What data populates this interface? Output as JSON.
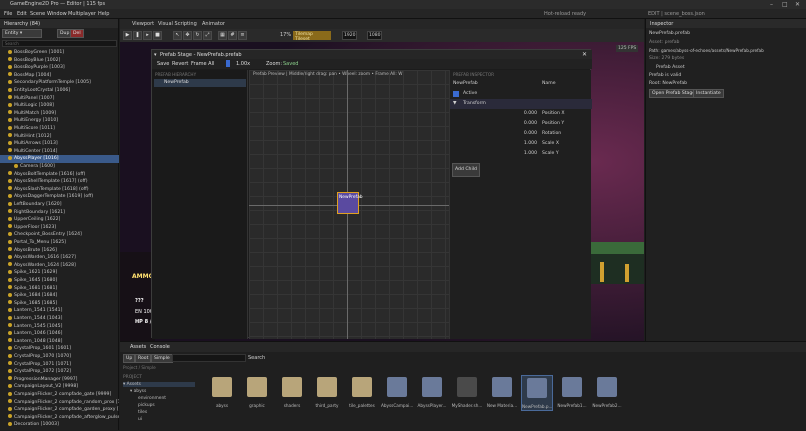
{
  "titlebar": {
    "title": "GameEngine2D Pro — Editor | 115 fps"
  },
  "menubar": {
    "items": [
      "File",
      "Edit",
      "Scene",
      "Window",
      "Multiplayer",
      "Help"
    ],
    "status": "Hot-reload ready",
    "edit_status": "EDIT | scene_boss.json"
  },
  "hierarchy": {
    "title": "Hierarchy (84)",
    "mode": "Entity",
    "dup": "Dup",
    "del": "Del",
    "search_placeholder": "Search",
    "items": [
      "BossBoyGreen [1001]",
      "BossBoyBlue [1002]",
      "BossBoyPurple [1003]",
      "BossMap [1004]",
      "SecondaryPlatformTemple [1005]",
      "EntityLootCrystal [1006]",
      "MultiPanel [1007]",
      "MultiLogic [1008]",
      "MultiMatch [1009]",
      "MultiEnergy [1010]",
      "MultiScore [1011]",
      "MultiHint [1012]",
      "MultiArrows [1013]",
      "MultiCenter [1014]",
      "AbyssPlayer [1016]",
      "Camera [1600]",
      "AbyssBoltTemplate [1616] (off)",
      "AbyssShellTemplate [1617] (off)",
      "AbyssSlashTemplate [1618] (off)",
      "AbyssDaggerTemplate [1619] (off)",
      "LeftBoundary [1620]",
      "RightBoundary [1621]",
      "UpperCeiling [1622]",
      "UpperFloor [1623]",
      "Checkpoint_BossEntry [1624]",
      "Portal_To_Menu [1625]",
      "AbyssBrute [1626]",
      "AbyssWarden_1616 [1627]",
      "AbyssWarden_1624 [1628]",
      "Spike_1621 [1629]",
      "Spike_1645 [1680]",
      "Spike_1681 [1681]",
      "Spike_1684 [1684]",
      "Spike_1685 [1685]",
      "Lantern_1541 [1541]",
      "Lantern_1544 [1043]",
      "Lantern_1545 [1045]",
      "Lantern_1046 [1046]",
      "Lantern_1048 [1048]",
      "CrystalProp_1601 [1601]",
      "CrystalProp_1070 [1070]",
      "CrystalProp_1071 [1071]",
      "CrystalProp_1072 [1072]",
      "ProgressionManager [9997]",
      "CampaignLayout_V2 [9998]",
      "CampaignFlicker_2 compfade_gate [9999]",
      "CampaignFlicker_2 compfade_random_prox [10000]",
      "CampaignFlicker_2 compfade_garden_proxy [10001]",
      "CampaignFlicker_2 compfade_afterglow_pulse [10002]",
      "Decoration [10003]"
    ]
  },
  "scene": {
    "tabs": [
      "Viewport",
      "Visual Scripting",
      "Animator"
    ],
    "toolbar_badge": "Tilemap Tileset",
    "zoom": "17%",
    "res_w": "1920",
    "res_h": "1080",
    "fps_badge": "125 FPS",
    "hud_texts": [
      "AMMO",
      "???",
      "EN 100",
      "HP 8 /"
    ]
  },
  "prefab": {
    "title": "Prefab Stage - NewPrefab.prefab",
    "buttons": [
      "Save",
      "Revert",
      "Frame All"
    ],
    "zoom_value": "1.00x",
    "zoom_label": "Zoom:",
    "saved": "Saved",
    "hierarchy_header": "PREFAB HIERARCHY",
    "root_item": "NewPrefab",
    "preview_header": "Prefab Preview | Middle/right drag: pan • Wheel: zoom • Frame All: W",
    "entity_label": "NewPrefab",
    "inspector_header": "PREFAB INSPECTOR",
    "name_value": "NewPrefab",
    "name_label": "Name",
    "active_label": "Active",
    "transform_label": "Transform",
    "fields": [
      {
        "value": "0.000",
        "label": "Position X"
      },
      {
        "value": "0.000",
        "label": "Position Y"
      },
      {
        "value": "0.000",
        "label": "Rotation"
      },
      {
        "value": "1.000",
        "label": "Scale X"
      },
      {
        "value": "1.000",
        "label": "Scale Y"
      }
    ],
    "add_child": "Add Child"
  },
  "inspector": {
    "title": "Inspector",
    "file": "NewPrefab.prefab",
    "asset_type": "Asset: prefab",
    "path": "Path: games/abyss-of-echoes/assets/NewPrefab.prefab",
    "size": "Size: 279 bytes",
    "section": "Prefab Asset",
    "valid": "Prefab is valid",
    "root": "Root: NewPrefab",
    "buttons": [
      "Open Prefab Stage",
      "Instantiate"
    ]
  },
  "assets": {
    "tabs": [
      "Assets",
      "Console"
    ],
    "buttons": [
      "Up",
      "Root",
      "Simple"
    ],
    "search_button": "Search",
    "breadcrumb": "Project / Simple",
    "tree_header": "PROJECT",
    "tree": [
      "Assets",
      "abyss",
      "environment",
      "pickups",
      "tiles",
      "ui"
    ],
    "items": [
      {
        "name": "abyss",
        "kind": "folder"
      },
      {
        "name": "graphic",
        "kind": "folder"
      },
      {
        "name": "shaders",
        "kind": "folder"
      },
      {
        "name": "third_party",
        "kind": "folder"
      },
      {
        "name": "tile_palettes",
        "kind": "folder"
      },
      {
        "name": "AbyssCampai...",
        "kind": "doc"
      },
      {
        "name": "AbyssPlayer...",
        "kind": "doc"
      },
      {
        "name": "MyShader.sh...",
        "kind": "ext"
      },
      {
        "name": "New Materia...",
        "kind": "doc"
      },
      {
        "name": "NewPrefab.p...",
        "kind": "doc"
      },
      {
        "name": "NewPrefab1...",
        "kind": "doc"
      },
      {
        "name": "NewPrefab2...",
        "kind": "doc"
      }
    ]
  }
}
